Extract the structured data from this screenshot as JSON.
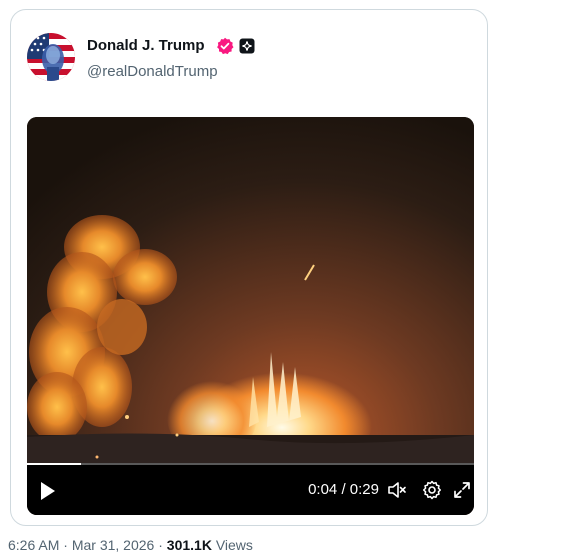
{
  "post": {
    "author": {
      "display_name": "Donald J. Trump",
      "handle": "@realDonaldTrump",
      "avatar_icon": "avatar-stars-stripes-portrait",
      "verified_color": "#f91880"
    },
    "video": {
      "current_time": "0:04",
      "separator": " / ",
      "duration": "0:29",
      "progress_fraction": 0.12,
      "muted": true
    },
    "meta": {
      "time": "6:26 AM",
      "dot": " · ",
      "date": "Mar 31, 2026",
      "dot2": " · ",
      "views_count": "301.1K",
      "views_label": " Views"
    }
  }
}
